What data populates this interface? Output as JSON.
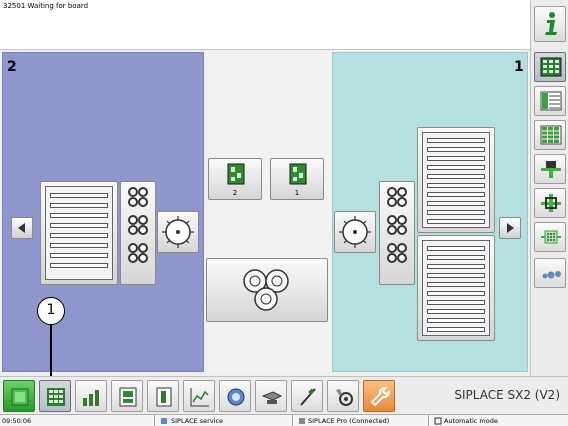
{
  "message": "32501 Waiting for board",
  "lanes": {
    "left_number": "2",
    "right_number": "1"
  },
  "board_buttons": [
    {
      "label": "2"
    },
    {
      "label": "1"
    }
  ],
  "machine_name": "SIPLACE SX2 (V2)",
  "callout_number": "1",
  "right_toolbar": {
    "icons": [
      "info-icon",
      "pcb-view-icon",
      "feeder-table-icon",
      "feeder-grid-icon",
      "placement-head-icon",
      "head-position-icon",
      "component-tray-icon",
      "nozzle-icon"
    ]
  },
  "bottom_toolbar": {
    "icons": [
      "production-icon",
      "feeder-layout-icon",
      "statistics-icon",
      "board-icon",
      "docs-icon",
      "chart-icon",
      "camera-icon",
      "conveyor-icon",
      "tweezers-icon",
      "service-icon",
      "wrench-icon"
    ]
  },
  "status": {
    "time": "09:50:06",
    "service": "SIPLACE service",
    "pro": "SIPLACE Pro (Connected)",
    "mode": "Automatic mode"
  },
  "colors": {
    "left_conveyor": "#8e96cc",
    "right_conveyor": "#b4e0e0",
    "accent_green": "#3cb43c",
    "accent_orange": "#f0a050"
  }
}
